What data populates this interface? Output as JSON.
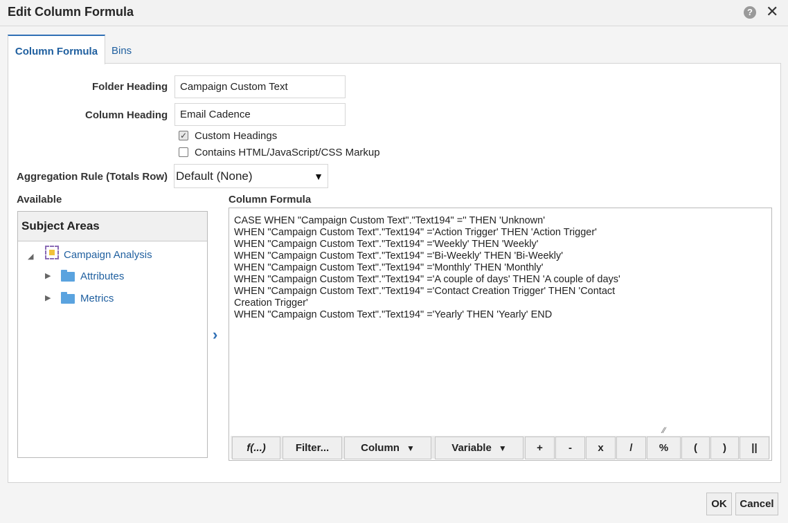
{
  "dialog": {
    "title": "Edit Column Formula",
    "help_icon": "?",
    "close_icon": "✕"
  },
  "tabs": [
    {
      "label": "Column Formula",
      "active": true
    },
    {
      "label": "Bins",
      "active": false
    }
  ],
  "form": {
    "folder_heading_label": "Folder Heading",
    "folder_heading_value": "Campaign Custom Text",
    "column_heading_label": "Column Heading",
    "column_heading_value": "Email Cadence",
    "custom_headings_label": "Custom Headings",
    "custom_headings_checked": true,
    "contains_markup_label": "Contains HTML/JavaScript/CSS Markup",
    "contains_markup_checked": false,
    "aggregation_label": "Aggregation Rule (Totals Row)",
    "aggregation_value": "Default (None)"
  },
  "available": {
    "label": "Available",
    "header": "Subject Areas",
    "root": "Campaign Analysis",
    "children": [
      "Attributes",
      "Metrics"
    ]
  },
  "formula": {
    "label": "Column Formula",
    "text": "CASE WHEN \"Campaign Custom Text\".\"Text194\" ='' THEN 'Unknown'\nWHEN \"Campaign Custom Text\".\"Text194\" ='Action Trigger' THEN 'Action Trigger'\nWHEN \"Campaign Custom Text\".\"Text194\" ='Weekly' THEN 'Weekly'\nWHEN \"Campaign Custom Text\".\"Text194\" ='Bi-Weekly' THEN 'Bi-Weekly'\nWHEN \"Campaign Custom Text\".\"Text194\" ='Monthly' THEN 'Monthly'\nWHEN \"Campaign Custom Text\".\"Text194\" ='A couple of days' THEN 'A couple of days'\nWHEN \"Campaign Custom Text\".\"Text194\" ='Contact Creation Trigger' THEN 'Contact\nCreation Trigger'\nWHEN \"Campaign Custom Text\".\"Text194\" ='Yearly' THEN 'Yearly' END",
    "toolbar": {
      "func": "f(...)",
      "filter": "Filter...",
      "column": "Column",
      "variable": "Variable",
      "plus": "+",
      "minus": "-",
      "times": "x",
      "divide": "/",
      "percent": "%",
      "lparen": "(",
      "rparen": ")",
      "concat": "||"
    }
  },
  "footer": {
    "ok": "OK",
    "cancel": "Cancel"
  }
}
